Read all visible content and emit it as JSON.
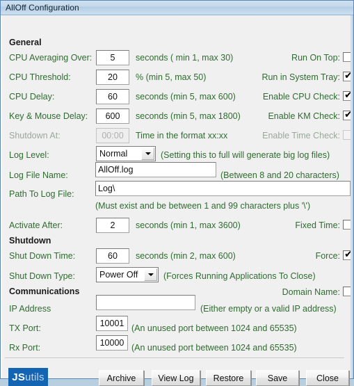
{
  "window": {
    "title": "AllOff Configuration"
  },
  "sections": {
    "general": "General",
    "shutdown": "Shutdown",
    "communications": "Communications"
  },
  "fields": {
    "cpu_averaging": {
      "label": "CPU Averaging Over:",
      "value": "5",
      "hint": "seconds ( min 1, max 30)"
    },
    "cpu_threshold": {
      "label": "CPU Threshold:",
      "value": "20",
      "hint": "% (min 5, max 50)"
    },
    "cpu_delay": {
      "label": "CPU Delay:",
      "value": "60",
      "hint": "seconds (min 5, max 600)"
    },
    "km_delay": {
      "label": "Key & Mouse Delay:",
      "value": "600",
      "hint": "seconds (min 5, max 1800)"
    },
    "shutdown_at": {
      "label": "Shutdown At:",
      "value": "00:00",
      "hint": "Time in the format xx:xx"
    },
    "log_level": {
      "label": "Log Level:",
      "value": "Normal",
      "hint": "(Setting this to full will generate big log files)"
    },
    "log_file_name": {
      "label": "Log File Name:",
      "value": "AllOff.log",
      "hint": "(Between 8 and 20 characters)"
    },
    "path_to_log": {
      "label": "Path To Log File:",
      "value": "Log\\",
      "hint": "(Must exist and be between 1 and 99 characters plus '\\')"
    },
    "activate_after": {
      "label": "Activate After:",
      "value": "2",
      "hint": "seconds (min 1, max 3600)"
    },
    "shut_down_time": {
      "label": "Shut Down Time:",
      "value": "60",
      "hint": "seconds (min 2, max 600)"
    },
    "shut_down_type": {
      "label": "Shut Down Type:",
      "value": "Power Off",
      "hint": "(Forces Running Applications To Close)"
    },
    "ip_address": {
      "label": "IP Address",
      "value": "",
      "hint": "(Either empty or a valid IP address)"
    },
    "tx_port": {
      "label": "TX Port:",
      "value": "10001",
      "hint": "(An unused port between 1024 and 65535)"
    },
    "rx_port": {
      "label": "Rx Port:",
      "value": "10000",
      "hint": "(An unused port between 1024 and 65535)"
    }
  },
  "checkboxes": {
    "run_on_top": {
      "label": "Run On Top:",
      "checked": false,
      "mark": ""
    },
    "run_in_system_tray": {
      "label": "Run in System Tray:",
      "checked": true,
      "mark": "✔"
    },
    "enable_cpu_check": {
      "label": "Enable CPU Check:",
      "checked": true,
      "mark": "✔"
    },
    "enable_km_check": {
      "label": "Enable KM Check:",
      "checked": true,
      "mark": "✔"
    },
    "enable_time_check": {
      "label": "Enable Time Check:",
      "checked": false,
      "mark": ""
    },
    "fixed_time": {
      "label": "Fixed Time:",
      "checked": false,
      "mark": ""
    },
    "force": {
      "label": "Force:",
      "checked": true,
      "mark": "✔"
    },
    "domain_name": {
      "label": "Domain Name:",
      "checked": false,
      "mark": ""
    }
  },
  "logo": {
    "part1": "JS",
    "part2": "utils"
  },
  "buttons": {
    "archive": "Archive",
    "view_log": "View Log",
    "restore": "Restore",
    "save": "Save",
    "close": "Close"
  },
  "colors": {
    "label_green": "#2f6b30",
    "logo_blue": "#1464b4",
    "titlebar_blue": "#c3d8ea"
  }
}
